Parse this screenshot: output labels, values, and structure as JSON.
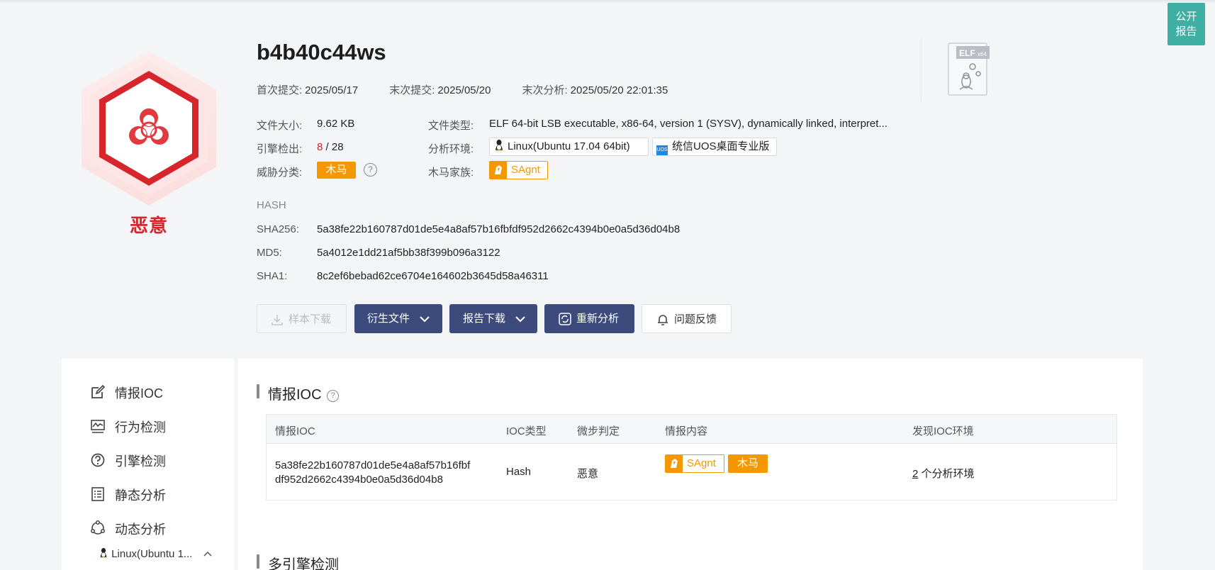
{
  "public_report": {
    "line1": "公开",
    "line2": "报告"
  },
  "verdict": "恶意",
  "title": "b4b40c44ws",
  "meta": {
    "first_submit_label": "首次提交:",
    "first_submit": "2025/05/17",
    "last_submit_label": "末次提交:",
    "last_submit": "2025/05/20",
    "last_analysis_label": "末次分析:",
    "last_analysis": "2025/05/20 22:01:35"
  },
  "file_icon": {
    "label": "ELF",
    "sub": "x64"
  },
  "info": {
    "size_label": "文件大小:",
    "size": "9.62 KB",
    "type_label": "文件类型:",
    "type": "ELF 64-bit LSB executable, x86-64, version 1 (SYSV), dynamically linked, interpret...",
    "engine_label": "引擎检出:",
    "engine_hits": "8",
    "engine_total": "/ 28",
    "env_label": "分析环境:",
    "env1": "Linux(Ubuntu 17.04 64bit)",
    "env2": "统信UOS桌面专业版",
    "env2_badge": "UOS",
    "threat_label": "威胁分类:",
    "threat": "木马",
    "family_label": "木马家族:",
    "family": "SAgnt"
  },
  "hash": {
    "heading": "HASH",
    "sha256_label": "SHA256:",
    "sha256": "5a38fe22b160787d01de5e4a8af57b16fbfdf952d2662c4394b0e0a5d36d04b8",
    "md5_label": "MD5:",
    "md5": "5a4012e1dd21af5bb38f399b096a3122",
    "sha1_label": "SHA1:",
    "sha1": "8c2ef6bebad62ce6704e164602b3645d58a46311"
  },
  "buttons": {
    "sample_download": "样本下载",
    "derived_files": "衍生文件",
    "report_download": "报告下载",
    "reanalyze": "重新分析",
    "feedback": "问题反馈"
  },
  "sidebar": {
    "items": [
      "情报IOC",
      "行为检测",
      "引擎检测",
      "静态分析",
      "动态分析"
    ],
    "sub_item": "Linux(Ubuntu 1..."
  },
  "ioc_section": {
    "title": "情报IOC",
    "headers": [
      "情报IOC",
      "IOC类型",
      "微步判定",
      "情报内容",
      "发现IOC环境"
    ],
    "row": {
      "ioc_line1": "5a38fe22b160787d01de5e4a8af57b16fbf",
      "ioc_line2": "df952d2662c4394b0e0a5d36d04b8",
      "type": "Hash",
      "judgement": "恶意",
      "family": "SAgnt",
      "threat": "木马",
      "env_count": "2",
      "env_suffix": " 个分析环境"
    }
  },
  "engine_section": {
    "title": "多引擎检测"
  },
  "colors": {
    "malicious": "#d7252c",
    "orange": "#f39800",
    "navy": "#3c4b7b",
    "teal": "#3faea3"
  }
}
